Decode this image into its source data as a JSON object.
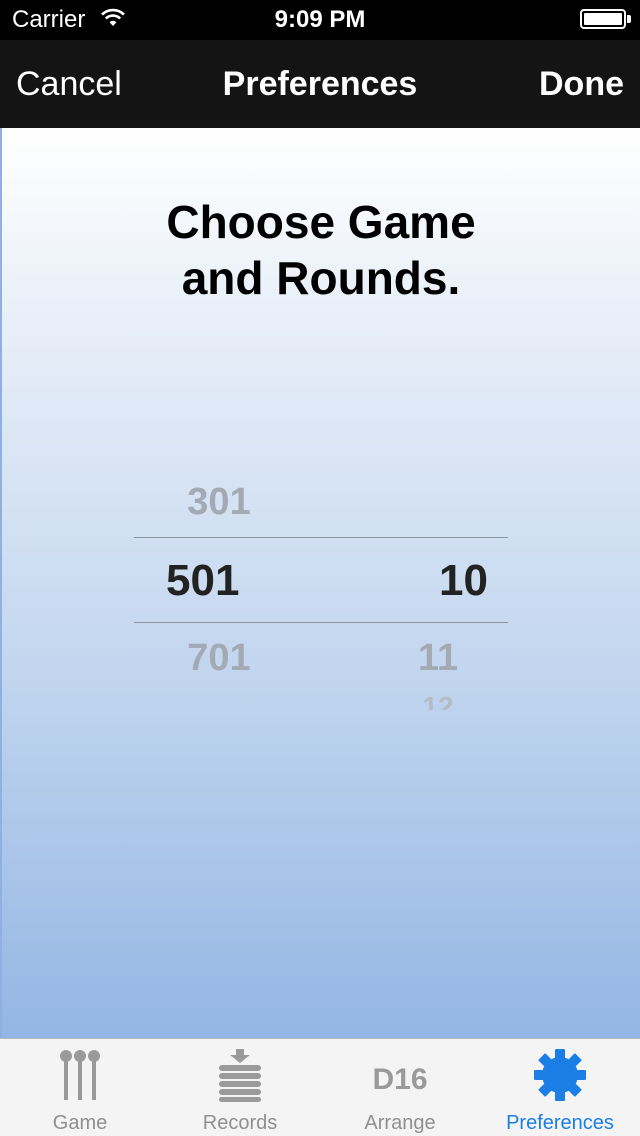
{
  "status_bar": {
    "carrier": "Carrier",
    "time": "9:09 PM"
  },
  "nav": {
    "cancel_label": "Cancel",
    "title": "Preferences",
    "done_label": "Done"
  },
  "content": {
    "heading_line1": "Choose Game",
    "heading_line2": "and Rounds."
  },
  "picker": {
    "game": {
      "above": "301",
      "selected": "501",
      "below": "701"
    },
    "rounds": {
      "selected": "10",
      "below": "11",
      "below2": "12"
    }
  },
  "tab_bar": {
    "tabs": [
      {
        "label": "Game",
        "icon": "darts-icon"
      },
      {
        "label": "Records",
        "icon": "stack-icon"
      },
      {
        "label": "Arrange",
        "icon": "d16-icon",
        "icon_text": "D16"
      },
      {
        "label": "Preferences",
        "icon": "gear-icon"
      }
    ],
    "active_index": 3
  },
  "colors": {
    "accent": "#1a7ee6",
    "inactive": "#909090",
    "nav_background": "#141414",
    "gradient_top": "#ffffff",
    "gradient_bottom": "#93b6e4"
  }
}
